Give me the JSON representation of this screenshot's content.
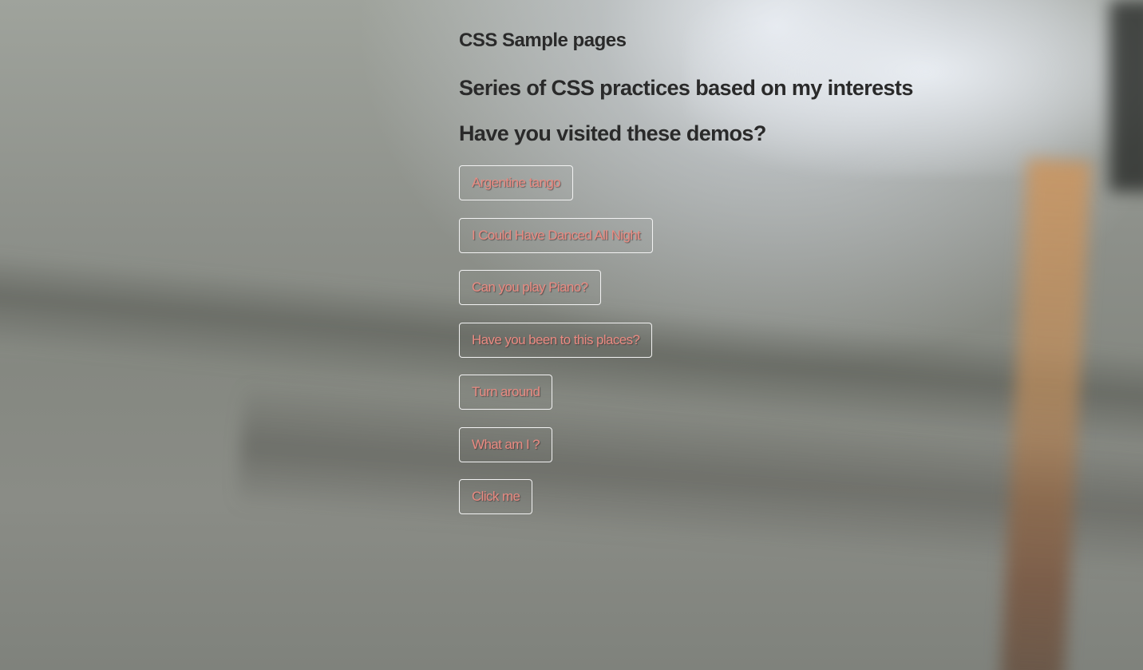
{
  "header": {
    "title": "CSS Sample pages",
    "subtitle": "Series of CSS practices based on my interests",
    "prompt": "Have you visited these demos?"
  },
  "demos": [
    {
      "label": "Argentine tango"
    },
    {
      "label": "I Could Have Danced All Night"
    },
    {
      "label": "Can you play Piano?"
    },
    {
      "label": "Have you been to this places?"
    },
    {
      "label": "Turn around"
    },
    {
      "label": "What am I ?"
    },
    {
      "label": "Click me"
    }
  ],
  "colors": {
    "text": "#2a2a2a",
    "link": "#e98b82",
    "link_border": "#f2f2f2"
  }
}
